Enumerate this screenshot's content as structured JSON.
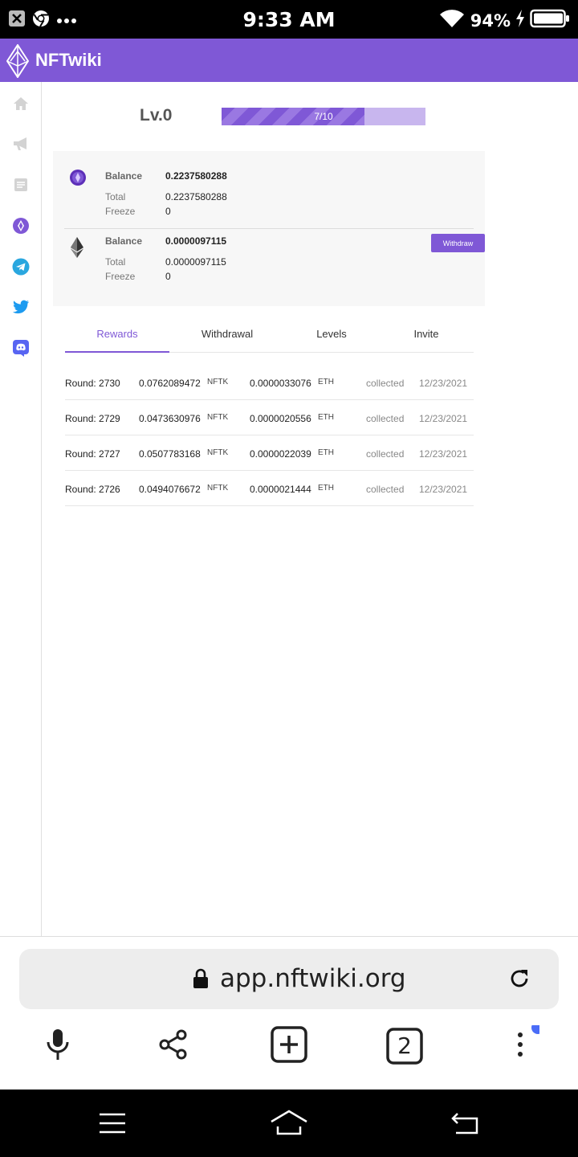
{
  "status_bar": {
    "time": "9:33 AM",
    "battery": "94%",
    "left_icons": [
      "close-notification-icon",
      "chrome-icon",
      "more-dots-icon"
    ],
    "right_icons": [
      "wifi-icon",
      "battery-charging-icon"
    ]
  },
  "app": {
    "title": "NFTwiki",
    "accent_color": "#7f58d6"
  },
  "sidebar": {
    "items": [
      {
        "icon": "home-icon"
      },
      {
        "icon": "megaphone-icon"
      },
      {
        "icon": "document-icon"
      },
      {
        "icon": "nftk-token-icon"
      },
      {
        "icon": "telegram-icon"
      },
      {
        "icon": "twitter-icon"
      },
      {
        "icon": "discord-icon"
      }
    ]
  },
  "level": {
    "label": "Lv.0",
    "progress_text": "7/10",
    "progress_fraction": 0.7
  },
  "wallets": [
    {
      "coin_icon": "nftk-coin-icon",
      "balance_label": "Balance",
      "balance": "0.2237580288",
      "total_label": "Total",
      "total": "0.2237580288",
      "freeze_label": "Freeze",
      "freeze": "0"
    },
    {
      "coin_icon": "ethereum-icon",
      "balance_label": "Balance",
      "balance": "0.0000097115",
      "total_label": "Total",
      "total": "0.0000097115",
      "freeze_label": "Freeze",
      "freeze": "0",
      "withdraw_label": "Withdraw"
    }
  ],
  "tabs": [
    {
      "label": "Rewards",
      "active": true
    },
    {
      "label": "Withdrawal",
      "active": false
    },
    {
      "label": "Levels",
      "active": false
    },
    {
      "label": "Invite",
      "active": false
    }
  ],
  "rewards": [
    {
      "round": "Round: 2730",
      "nftk": "0.0762089472",
      "nftk_unit": "NFTK",
      "eth": "0.0000033076",
      "eth_unit": "ETH",
      "status": "collected",
      "date": "12/23/2021"
    },
    {
      "round": "Round: 2729",
      "nftk": "0.0473630976",
      "nftk_unit": "NFTK",
      "eth": "0.0000020556",
      "eth_unit": "ETH",
      "status": "collected",
      "date": "12/23/2021"
    },
    {
      "round": "Round: 2727",
      "nftk": "0.0507783168",
      "nftk_unit": "NFTK",
      "eth": "0.0000022039",
      "eth_unit": "ETH",
      "status": "collected",
      "date": "12/23/2021"
    },
    {
      "round": "Round: 2726",
      "nftk": "0.0494076672",
      "nftk_unit": "NFTK",
      "eth": "0.0000021444",
      "eth_unit": "ETH",
      "status": "collected",
      "date": "12/23/2021"
    }
  ],
  "browser": {
    "url": "app.nftwiki.org",
    "tab_count": "2",
    "toolbar_icons": [
      "microphone-icon",
      "share-icon",
      "new-tab-icon",
      "tabs-icon",
      "menu-icon"
    ]
  },
  "nav_bar": {
    "icons": [
      "recents-icon",
      "home-icon",
      "back-icon"
    ]
  }
}
